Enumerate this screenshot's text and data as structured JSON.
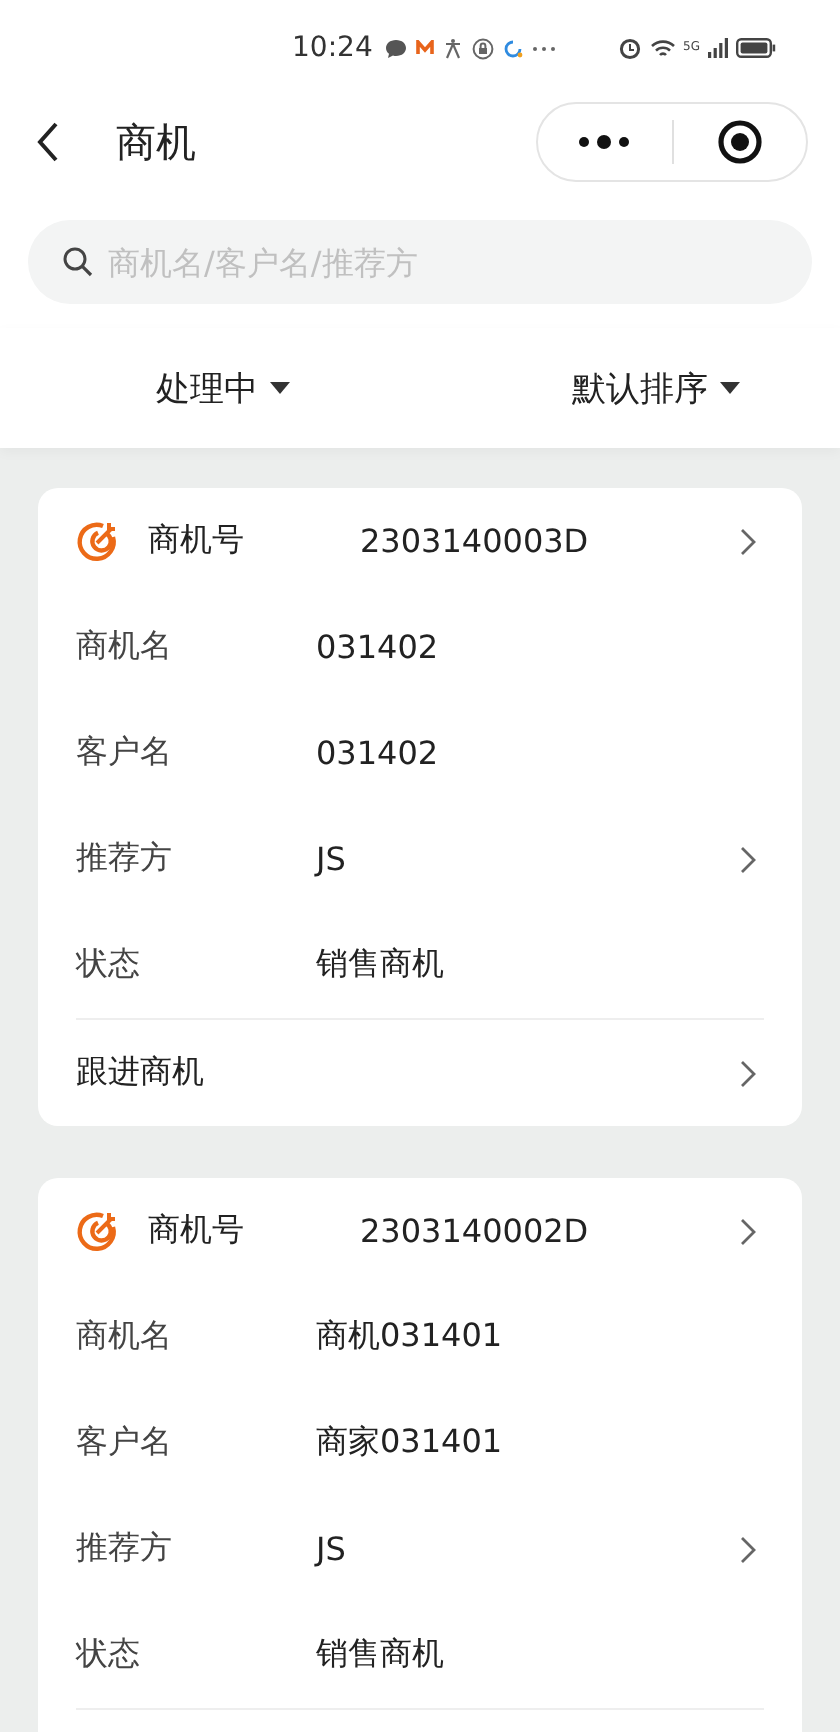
{
  "status_bar": {
    "time": "10:24",
    "network": "5G"
  },
  "nav": {
    "title": "商机"
  },
  "search": {
    "placeholder": "商机名/客户名/推荐方"
  },
  "filters": [
    {
      "label": "处理中"
    },
    {
      "label": "默认排序"
    }
  ],
  "cards": [
    {
      "rows": [
        {
          "kind": "header",
          "label": "商机号",
          "value": "2303140003D",
          "chevron": true
        },
        {
          "kind": "field",
          "label": "商机名",
          "value": "031402",
          "chevron": false
        },
        {
          "kind": "field",
          "label": "客户名",
          "value": "031402",
          "chevron": false
        },
        {
          "kind": "field",
          "label": "推荐方",
          "value": "JS",
          "chevron": true
        },
        {
          "kind": "field",
          "label": "状态",
          "value": "销售商机",
          "chevron": false
        },
        {
          "kind": "action",
          "label": "跟进商机",
          "chevron": true
        }
      ]
    },
    {
      "rows": [
        {
          "kind": "header",
          "label": "商机号",
          "value": "2303140002D",
          "chevron": true
        },
        {
          "kind": "field",
          "label": "商机名",
          "value": "商机031401",
          "chevron": false
        },
        {
          "kind": "field",
          "label": "客户名",
          "value": "商家031401",
          "chevron": false
        },
        {
          "kind": "field",
          "label": "推荐方",
          "value": "JS",
          "chevron": true
        },
        {
          "kind": "field",
          "label": "状态",
          "value": "销售商机",
          "chevron": false
        }
      ]
    }
  ]
}
